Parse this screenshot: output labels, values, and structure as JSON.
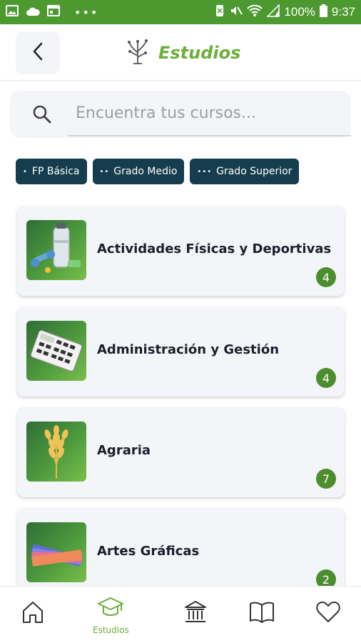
{
  "status_bar": {
    "battery": "100%",
    "time": "9:37"
  },
  "header": {
    "title": "Estudios"
  },
  "search": {
    "placeholder": "Encuentra tus cursos..."
  },
  "filters": [
    {
      "dots": "•",
      "label": "FP Básica"
    },
    {
      "dots": "••",
      "label": "Grado Medio"
    },
    {
      "dots": "•••",
      "label": "Grado Superior"
    }
  ],
  "categories": [
    {
      "label": "Actividades Físicas y Deportivas",
      "count": "4",
      "icon": "water-bottle-dumbbell-icon"
    },
    {
      "label": "Administración y Gestión",
      "count": "4",
      "icon": "calculator-icon"
    },
    {
      "label": "Agraria",
      "count": "7",
      "icon": "wheat-icon"
    },
    {
      "label": "Artes Gráficas",
      "count": "2",
      "icon": "color-swatches-icon"
    }
  ],
  "bottom_nav": {
    "active_label": "Estudios",
    "items": [
      "home-icon",
      "graduation-cap-icon",
      "institution-icon",
      "book-icon",
      "heart-icon"
    ]
  },
  "colors": {
    "accent": "#6cae3c",
    "status_bar": "#4c9a2f",
    "chip": "#153d4d",
    "badge": "#4c8d2d"
  }
}
